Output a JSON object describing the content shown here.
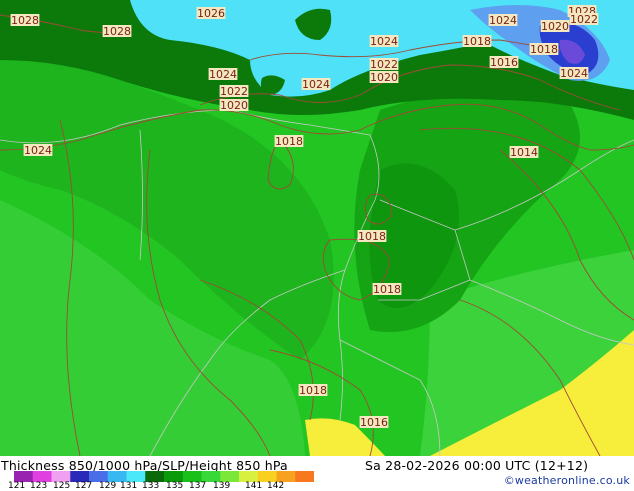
{
  "title": "Thickness 850/1000 hPa/SLP/Height 850 hPa",
  "valid_time": "Sa 28-02-2026 00:00 UTC (12+12)",
  "credit": "©weatheronline.co.uk",
  "colorbar": {
    "ticks": [
      "121",
      "123",
      "125",
      "127",
      "129",
      "131",
      "133",
      "135",
      "137",
      "139",
      "141",
      "142"
    ],
    "colors": [
      "#9a22b0",
      "#e040e0",
      "#f0a0f0",
      "#2a2ab8",
      "#4a6ee8",
      "#38b8f0",
      "#4ae8f8",
      "#0a6a0a",
      "#0a9a0a",
      "#1ac01a",
      "#38d838",
      "#7ae838",
      "#d8f040",
      "#f8d020",
      "#f8a020",
      "#f87820"
    ]
  },
  "isobar_labels": [
    "1028",
    "1028",
    "1026",
    "1028",
    "1024",
    "1024",
    "1020",
    "1022",
    "1020",
    "1022",
    "1024",
    "1024",
    "1024",
    "1022",
    "1020",
    "1018",
    "1018",
    "1016",
    "1014",
    "1018",
    "1018",
    "1018",
    "1016",
    "1024",
    "1018"
  ],
  "colors": {
    "ocean_cyan": "#4fe1f7",
    "deep_blue": "#2a3fd0",
    "dark_green": "#0b7a0b",
    "mid_green": "#119e11",
    "bright_green": "#22c522",
    "light_green": "#3ad13a",
    "yellow": "#f6ee3a",
    "isobar": "#a04a36",
    "border": "#c8c8c8"
  }
}
